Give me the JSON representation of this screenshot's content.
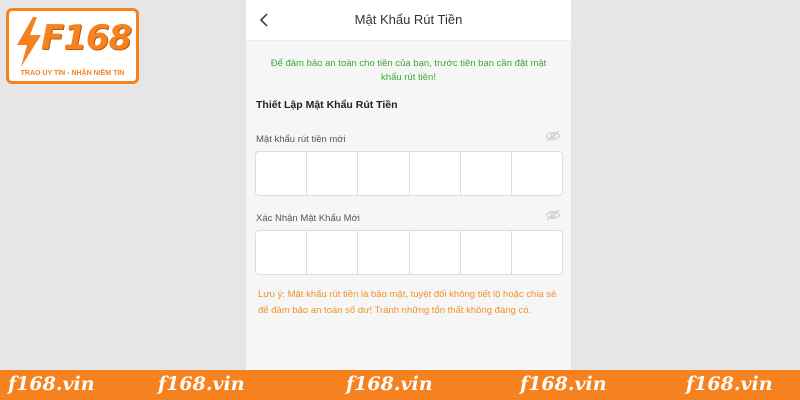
{
  "logo": {
    "brand": "F168",
    "slogan": "TRAO UY TÍN - NHẬN NIỀM TIN"
  },
  "header": {
    "title": "Mật Khẩu Rút Tiền",
    "back_icon": "chevron-left-icon"
  },
  "notice": "Để đảm bảo an toàn cho tiền của bạn, trước tiên bạn cần đặt mật khẩu rút tiền!",
  "section_title": "Thiết Lập Mật Khẩu Rút Tiền",
  "fields": [
    {
      "label": "Mật khẩu rút tiền mới",
      "icon": "eye-icon",
      "digits": 6
    },
    {
      "label": "Xác Nhận Mật Khẩu Mới",
      "icon": "eye-icon",
      "digits": 6
    }
  ],
  "warning": "Lưu ý: Mật khẩu rút tiền là bảo mật, tuyệt đối không tiết lộ hoặc chia sẻ để đảm bảo an toàn số dư! Tránh những tổn thất không đáng có.",
  "footer": {
    "items": [
      "f168.vin",
      "f168.vin",
      "f168.vin",
      "f168.vin",
      "f168.vin"
    ]
  },
  "colors": {
    "accent": "#f5821f",
    "notice": "#3aa935",
    "warning": "#f0922b"
  }
}
